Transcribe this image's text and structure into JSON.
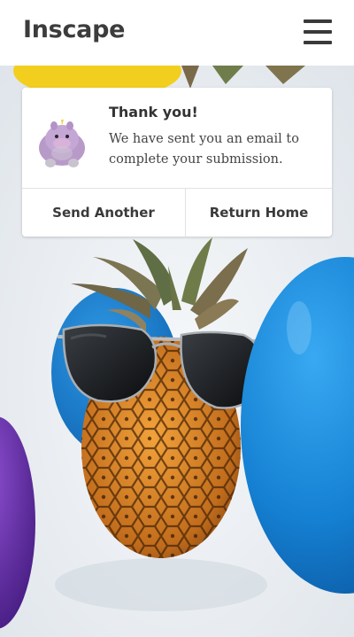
{
  "header": {
    "logo_text": "Inscape",
    "menu_icon": "hamburger-menu-icon"
  },
  "confirmation_card": {
    "avatar_icon": "purple-unicorn-plush-avatar",
    "title": "Thank you!",
    "message": "We have sent you an email to complete your submission.",
    "send_another_label": "Send Another",
    "return_home_label": "Return Home"
  },
  "background": {
    "description_icon": "pineapple-with-sunglasses-and-balloons-photo"
  },
  "colors": {
    "header_bg": "#ffffff",
    "text_dark": "#3c3c3c",
    "balloon_blue": "#1a86d8",
    "balloon_purple": "#5a2a9a",
    "balloon_yellow": "#f2cf1f"
  }
}
